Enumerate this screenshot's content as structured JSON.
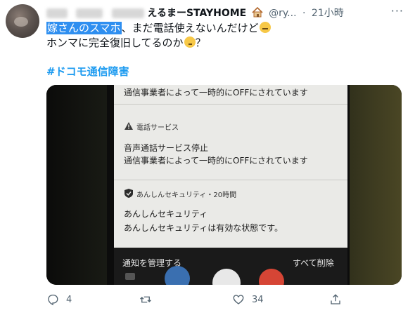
{
  "tweet": {
    "author_name_suffix": "えるまーSTAYHOME",
    "handle": "@ry...",
    "separator": "·",
    "time": "21小時",
    "text_highlight": "嫁さんのスマホ",
    "text_line1_rest": "、まだ電話使えないんだけど",
    "text_line2": "ホンマに完全復旧してるのか",
    "text_line2_end": "？",
    "hashtag": "#ドコモ通信障害"
  },
  "notification_screen": {
    "line_top": "通信事業者によって一時的にOFFにされています",
    "phone_section_title": "電話サービス",
    "phone_line1": "音声通話サービス停止",
    "phone_line2": "通信事業者によって一時的にOFFにされています",
    "security_title": "あんしんセキュリティ・20時間",
    "security_line1": "あんしんセキュリティ",
    "security_line2": "あんしんセキュリティは有効な状態です。",
    "manage_label": "通知を管理する",
    "clear_label": "すべて削除"
  },
  "actions": {
    "reply_count": "4",
    "like_count": "34"
  },
  "colors": {
    "link": "#1d9bf0",
    "highlight": "#2f8ff0",
    "muted": "#536471"
  }
}
